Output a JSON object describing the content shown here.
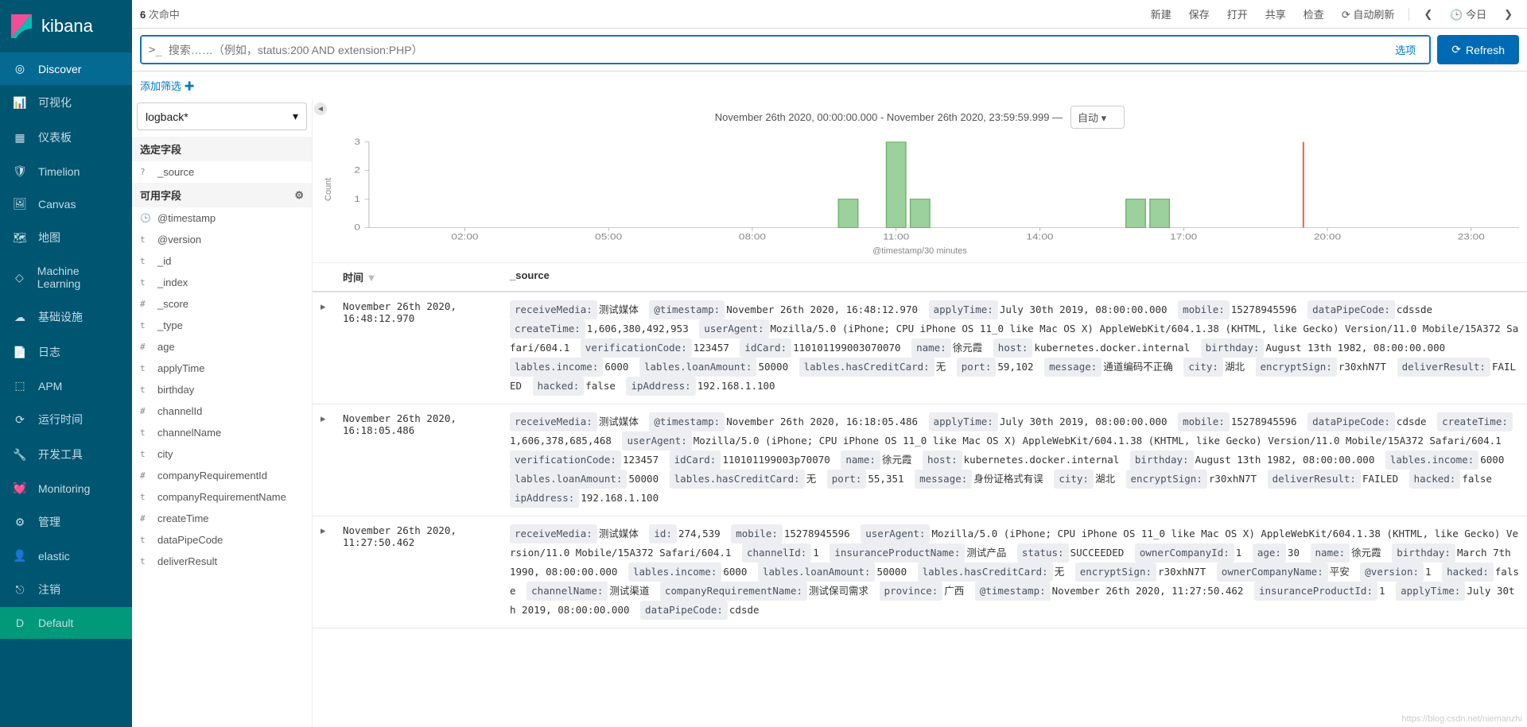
{
  "brand": "kibana",
  "sidebar": {
    "items": [
      {
        "label": "Discover",
        "icon": "compass",
        "active": true
      },
      {
        "label": "可视化",
        "icon": "bar-chart"
      },
      {
        "label": "仪表板",
        "icon": "dashboard"
      },
      {
        "label": "Timelion",
        "icon": "timelion"
      },
      {
        "label": "Canvas",
        "icon": "canvas"
      },
      {
        "label": "地图",
        "icon": "map"
      },
      {
        "label": "Machine Learning",
        "icon": "ml"
      },
      {
        "label": "基础设施",
        "icon": "infra"
      },
      {
        "label": "日志",
        "icon": "logs"
      },
      {
        "label": "APM",
        "icon": "apm"
      },
      {
        "label": "运行时间",
        "icon": "uptime"
      },
      {
        "label": "开发工具",
        "icon": "devtools"
      },
      {
        "label": "Monitoring",
        "icon": "monitoring"
      },
      {
        "label": "管理",
        "icon": "gear"
      },
      {
        "label": "elastic",
        "icon": "user"
      },
      {
        "label": "注销",
        "icon": "logout"
      },
      {
        "label": "Default",
        "icon": "default"
      }
    ]
  },
  "topbar": {
    "hit_count": "6",
    "hit_label": " 次命中",
    "links": [
      "新建",
      "保存",
      "打开",
      "共享",
      "检查"
    ],
    "auto_refresh": "自动刷新",
    "today": "今日"
  },
  "query": {
    "prompt": ">_",
    "placeholder": "搜索……（例如，status:200 AND extension:PHP）",
    "options": "选项",
    "refresh": "Refresh"
  },
  "filter": {
    "add": "添加筛选"
  },
  "index_pattern": "logback*",
  "fields": {
    "selected_header": "选定字段",
    "selected": [
      {
        "type": "?",
        "name": "_source"
      }
    ],
    "available_header": "可用字段",
    "available": [
      {
        "type": "🕒",
        "name": "@timestamp"
      },
      {
        "type": "t",
        "name": "@version"
      },
      {
        "type": "t",
        "name": "_id"
      },
      {
        "type": "t",
        "name": "_index"
      },
      {
        "type": "#",
        "name": "_score"
      },
      {
        "type": "t",
        "name": "_type"
      },
      {
        "type": "#",
        "name": "age"
      },
      {
        "type": "t",
        "name": "applyTime"
      },
      {
        "type": "t",
        "name": "birthday"
      },
      {
        "type": "#",
        "name": "channelId"
      },
      {
        "type": "t",
        "name": "channelName"
      },
      {
        "type": "t",
        "name": "city"
      },
      {
        "type": "#",
        "name": "companyRequirementId"
      },
      {
        "type": "t",
        "name": "companyRequirementName"
      },
      {
        "type": "#",
        "name": "createTime"
      },
      {
        "type": "t",
        "name": "dataPipeCode"
      },
      {
        "type": "t",
        "name": "deliverResult"
      }
    ]
  },
  "histogram": {
    "range_text": "November 26th 2020, 00:00:00.000 - November 26th 2020, 23:59:59.999 —",
    "interval_select": "自动",
    "ylabel": "Count",
    "xlabel": "@timestamp/30 minutes"
  },
  "chart_data": {
    "type": "bar",
    "categories_visible": [
      "02:00",
      "05:00",
      "08:00",
      "11:00",
      "14:00",
      "17:00",
      "20:00",
      "23:00"
    ],
    "xlabel": "@timestamp/30 minutes",
    "ylabel": "Count",
    "ylim": [
      0,
      3
    ],
    "bars": [
      {
        "time": "10:00",
        "value": 1
      },
      {
        "time": "11:00",
        "value": 3
      },
      {
        "time": "11:30",
        "value": 1
      },
      {
        "time": "16:00",
        "value": 1
      },
      {
        "time": "16:30",
        "value": 1
      }
    ],
    "now_marker": "19:30"
  },
  "table": {
    "columns": {
      "time": "时间",
      "source": "_source"
    },
    "rows": [
      {
        "time": "November 26th 2020, 16:48:12.970",
        "fields": [
          {
            "k": "receiveMedia:",
            "v": "测试媒体"
          },
          {
            "k": "@timestamp:",
            "v": "November 26th 2020, 16:48:12.970"
          },
          {
            "k": "applyTime:",
            "v": "July 30th 2019, 08:00:00.000"
          },
          {
            "k": "mobile:",
            "v": "15278945596"
          },
          {
            "k": "dataPipeCode:",
            "v": "cdssde"
          },
          {
            "k": "createTime:",
            "v": "1,606,380,492,953"
          },
          {
            "k": "userAgent:",
            "v": "Mozilla/5.0 (iPhone; CPU iPhone OS 11_0 like Mac OS X) AppleWebKit/604.1.38 (KHTML, like Gecko) Version/11.0 Mobile/15A372 Safari/604.1"
          },
          {
            "k": "verificationCode:",
            "v": "123457"
          },
          {
            "k": "idCard:",
            "v": "110101199003070070"
          },
          {
            "k": "name:",
            "v": "徐元霞"
          },
          {
            "k": "host:",
            "v": "kubernetes.docker.internal"
          },
          {
            "k": "birthday:",
            "v": "August 13th 1982, 08:00:00.000"
          },
          {
            "k": "lables.income:",
            "v": "6000"
          },
          {
            "k": "lables.loanAmount:",
            "v": "50000"
          },
          {
            "k": "lables.hasCreditCard:",
            "v": "无"
          },
          {
            "k": "port:",
            "v": "59,102"
          },
          {
            "k": "message:",
            "v": "通道编码不正确"
          },
          {
            "k": "city:",
            "v": "湖北"
          },
          {
            "k": "encryptSign:",
            "v": "r30xhN7T"
          },
          {
            "k": "deliverResult:",
            "v": "FAILED"
          },
          {
            "k": "hacked:",
            "v": "false"
          },
          {
            "k": "ipAddress:",
            "v": "192.168.1.100"
          }
        ]
      },
      {
        "time": "November 26th 2020, 16:18:05.486",
        "fields": [
          {
            "k": "receiveMedia:",
            "v": "测试媒体"
          },
          {
            "k": "@timestamp:",
            "v": "November 26th 2020, 16:18:05.486"
          },
          {
            "k": "applyTime:",
            "v": "July 30th 2019, 08:00:00.000"
          },
          {
            "k": "mobile:",
            "v": "15278945596"
          },
          {
            "k": "dataPipeCode:",
            "v": "cdsde"
          },
          {
            "k": "createTime:",
            "v": "1,606,378,685,468"
          },
          {
            "k": "userAgent:",
            "v": "Mozilla/5.0 (iPhone; CPU iPhone OS 11_0 like Mac OS X) AppleWebKit/604.1.38 (KHTML, like Gecko) Version/11.0 Mobile/15A372 Safari/604.1"
          },
          {
            "k": "verificationCode:",
            "v": "123457"
          },
          {
            "k": "idCard:",
            "v": "110101199003p70070"
          },
          {
            "k": "name:",
            "v": "徐元霞"
          },
          {
            "k": "host:",
            "v": "kubernetes.docker.internal"
          },
          {
            "k": "birthday:",
            "v": "August 13th 1982, 08:00:00.000"
          },
          {
            "k": "lables.income:",
            "v": "6000"
          },
          {
            "k": "lables.loanAmount:",
            "v": "50000"
          },
          {
            "k": "lables.hasCreditCard:",
            "v": "无"
          },
          {
            "k": "port:",
            "v": "55,351"
          },
          {
            "k": "message:",
            "v": "身份证格式有误"
          },
          {
            "k": "city:",
            "v": "湖北"
          },
          {
            "k": "encryptSign:",
            "v": "r30xhN7T"
          },
          {
            "k": "deliverResult:",
            "v": "FAILED"
          },
          {
            "k": "hacked:",
            "v": "false"
          },
          {
            "k": "ipAddress:",
            "v": "192.168.1.100"
          }
        ]
      },
      {
        "time": "November 26th 2020, 11:27:50.462",
        "fields": [
          {
            "k": "receiveMedia:",
            "v": "测试媒体"
          },
          {
            "k": "id:",
            "v": "274,539"
          },
          {
            "k": "mobile:",
            "v": "15278945596"
          },
          {
            "k": "userAgent:",
            "v": "Mozilla/5.0 (iPhone; CPU iPhone OS 11_0 like Mac OS X) AppleWebKit/604.1.38 (KHTML, like Gecko) Version/11.0 Mobile/15A372 Safari/604.1"
          },
          {
            "k": "channelId:",
            "v": "1"
          },
          {
            "k": "insuranceProductName:",
            "v": "测试产品"
          },
          {
            "k": "status:",
            "v": "SUCCEEDED"
          },
          {
            "k": "ownerCompanyId:",
            "v": "1"
          },
          {
            "k": "age:",
            "v": "30"
          },
          {
            "k": "name:",
            "v": "徐元霞"
          },
          {
            "k": "birthday:",
            "v": "March 7th 1990, 08:00:00.000"
          },
          {
            "k": "lables.income:",
            "v": "6000"
          },
          {
            "k": "lables.loanAmount:",
            "v": "50000"
          },
          {
            "k": "lables.hasCreditCard:",
            "v": "无"
          },
          {
            "k": "encryptSign:",
            "v": "r30xhN7T"
          },
          {
            "k": "ownerCompanyName:",
            "v": "平安"
          },
          {
            "k": "@version:",
            "v": "1"
          },
          {
            "k": "hacked:",
            "v": "false"
          },
          {
            "k": "channelName:",
            "v": "测试渠道"
          },
          {
            "k": "companyRequirementName:",
            "v": "测试保司需求"
          },
          {
            "k": "province:",
            "v": "广西"
          },
          {
            "k": "@timestamp:",
            "v": "November 26th 2020, 11:27:50.462"
          },
          {
            "k": "insuranceProductId:",
            "v": "1"
          },
          {
            "k": "applyTime:",
            "v": "July 30th 2019, 08:00:00.000"
          },
          {
            "k": "dataPipeCode:",
            "v": "cdsde"
          }
        ]
      }
    ]
  },
  "watermark": "https://blog.csdn.net/niemanzhi"
}
